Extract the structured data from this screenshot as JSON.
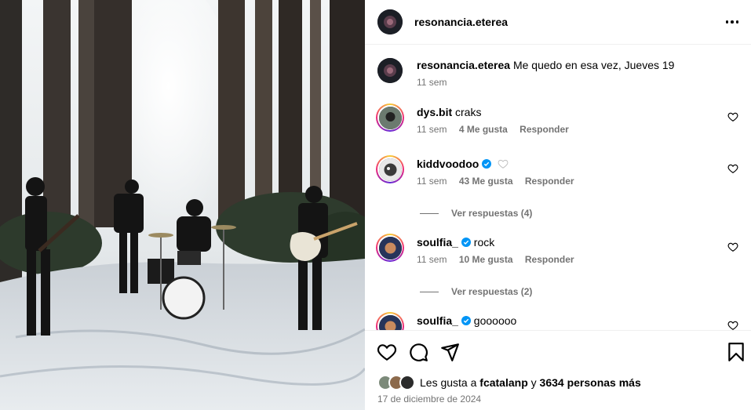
{
  "post": {
    "author": "resonancia.eterea",
    "caption_author": "resonancia.eterea",
    "caption_text": "Me quedo en esa vez, Jueves 19",
    "caption_time": "11 sem"
  },
  "comments": [
    {
      "username": "dys.bit",
      "text": "craks",
      "time": "11 sem",
      "likes": "4 Me gusta",
      "reply": "Responder",
      "verified": false
    },
    {
      "username": "kiddvoodoo",
      "text": "",
      "time": "11 sem",
      "likes": "43 Me gusta",
      "reply": "Responder",
      "verified": true,
      "replies": "Ver respuestas (4)"
    },
    {
      "username": "soulfia_",
      "text": "rock",
      "time": "11 sem",
      "likes": "10 Me gusta",
      "reply": "Responder",
      "verified": true,
      "replies": "Ver respuestas (2)"
    },
    {
      "username": "soulfia_",
      "text": "goooooo",
      "verified": true
    }
  ],
  "footer": {
    "likes_prefix": "Les gusta a",
    "likes_user": "fcatalanp",
    "likes_conj": "y",
    "likes_others": "3634 personas más",
    "date": "17 de diciembre de 2024"
  },
  "icons": {
    "more": "more-horizontal-icon",
    "like": "heart-icon",
    "comment": "comment-icon",
    "share": "send-icon",
    "save": "bookmark-icon",
    "verified": "verified-badge-icon"
  },
  "colors": {
    "verified": "#0095f6",
    "muted": "#737373",
    "divider": "#efefef"
  }
}
